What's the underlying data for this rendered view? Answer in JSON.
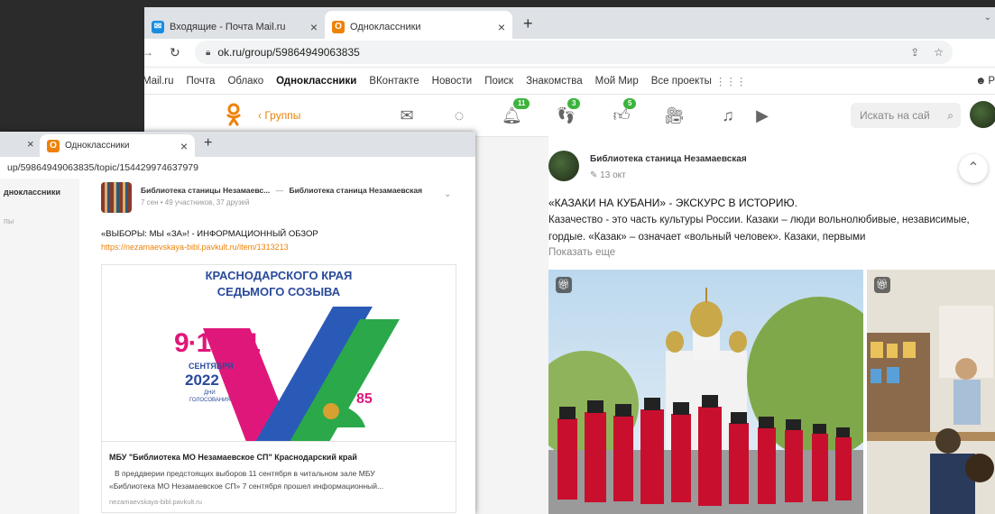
{
  "back_window": {
    "tabs": [
      {
        "title": "Входящие - Почта Mail.ru",
        "active": false
      },
      {
        "title": "Одноклассники",
        "active": true
      }
    ],
    "new_tab": "+",
    "url": "ok.ru/group/59864949063835",
    "services": [
      "Mail.ru",
      "Почта",
      "Облако",
      "Одноклассники",
      "ВКонтакте",
      "Новости",
      "Поиск",
      "Знакомства",
      "Мой Мир",
      "Все проекты"
    ],
    "services_active": "Одноклассники",
    "services_right": "Р",
    "groups_label": "Группы",
    "badges": {
      "notifications": "11",
      "guests": "3",
      "likes": "5"
    },
    "search_placeholder": "Искать на сай",
    "post": {
      "author": "Библиотека станица Незамаевская",
      "date": "13 окт",
      "title": "«КАЗАКИ НА КУБАНИ» - ЭКСКУРС В ИСТОРИЮ.",
      "text": "Казачество - это часть культуры России. Казаки – люди вольнолюбивые, независимые, гордые. «Казак» – означает «вольный человек». Казаки, первыми",
      "show_more": "Показать еще"
    }
  },
  "front_window": {
    "tabs": [
      {
        "title": "Одноклассники",
        "active": true
      }
    ],
    "new_tab": "+",
    "url": "up/59864949063835/topic/154429974637979",
    "left_pane": {
      "line1": "дноклассники",
      "line2": "пы"
    },
    "post": {
      "author": "Библиотека станицы Незамаевс...",
      "separator": "—",
      "group": "Библиотека станица Незамаевская",
      "meta": "7 сен • 49 участников, 37 друзей",
      "title": "«ВЫБОРЫ: МЫ «ЗА»! - ИНФОРМАЦИОННЫЙ ОБЗОР",
      "link": "https://nezamaevskaya-bibl.pavkult.ru/item/1313213",
      "poster": {
        "line1": "КРАСНОДАРСКОГО КРАЯ",
        "line2": "СЕДЬМОГО СОЗЫВА",
        "dates": "9·10·11",
        "month": "СЕНТЯБРЯ",
        "year": "2022",
        "days_label1": "ДНИ",
        "days_label2": "ГОЛОСОВАНИЯ",
        "anniv": "85"
      },
      "link_title": "МБУ \"Библиотека МО Незамаевское СП\" Краснодарский край",
      "link_desc1": "В преддверии предстоящих выборов 11 сентября в читальном зале МБУ",
      "link_desc2": "«Библиотека МО Незамаевское СП» 7 сентября прошел информационный...",
      "link_domain": "nezamaevskaya-bibl.pavkult.ru"
    }
  },
  "colors": {
    "ok_orange": "#ee8208",
    "badge_green": "#3cb43c",
    "poster_blue": "#2a4a9a",
    "poster_pink": "#e0177a"
  }
}
